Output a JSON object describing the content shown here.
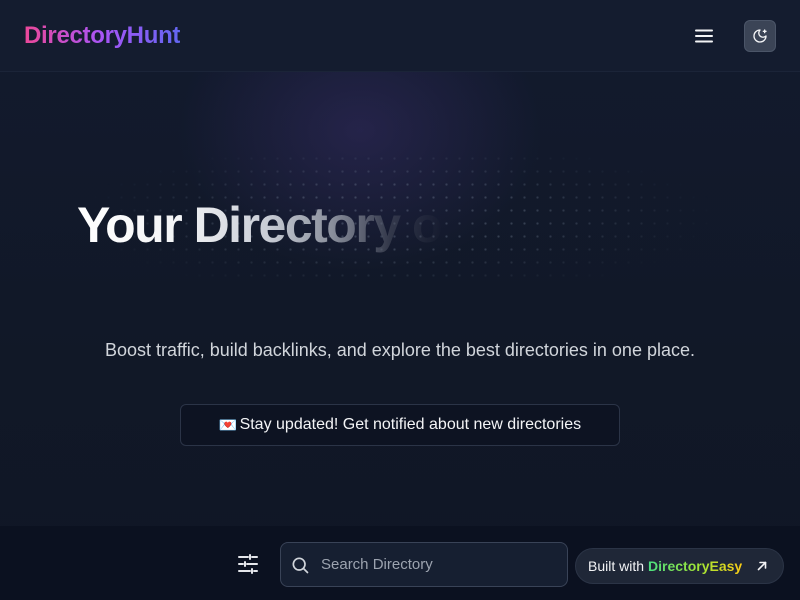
{
  "header": {
    "logo": "DirectoryHunt",
    "menu_icon": "hamburger-menu-icon",
    "theme_icon": "moon-icon"
  },
  "hero": {
    "title": "Your Directory o",
    "subtitle": "Boost traffic, build backlinks, and explore the best directories in one place.",
    "cta_emoji": "💌",
    "cta_label": "Stay updated! Get notified about new directories"
  },
  "bottom_bar": {
    "filter_icon": "sliders-icon",
    "search": {
      "icon": "search-icon",
      "placeholder": "Search Directory",
      "value": ""
    },
    "built_with": {
      "prefix": "Built with",
      "brand": "DirectoryEasy",
      "icon": "arrow-up-right-icon"
    }
  },
  "colors": {
    "background": "#111827",
    "logo_gradient_start": "#ec4899",
    "logo_gradient_end": "#6366f1",
    "brand_gradient_start": "#4ade80",
    "brand_gradient_end": "#facc15"
  }
}
